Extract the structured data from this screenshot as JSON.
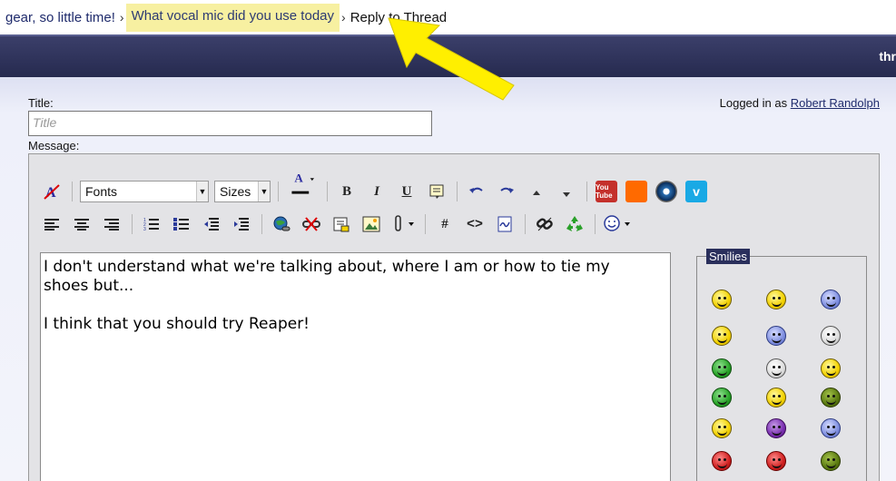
{
  "breadcrumb": {
    "item1": "gear, so little time!",
    "sep": "›",
    "item2": "What vocal mic did you use today",
    "current": "Reply to Thread"
  },
  "navbar": {
    "right_text": "thr"
  },
  "form": {
    "title_label": "Title:",
    "title_placeholder": "Title",
    "message_label": "Message:",
    "logged_in_prefix": "Logged in as",
    "logged_in_user": "Robert Randolph"
  },
  "toolbar": {
    "fonts": "Fonts",
    "sizes": "Sizes",
    "bold": "B",
    "italic": "I",
    "underline": "U",
    "hash": "#",
    "code": "<>",
    "youtube": "You Tube",
    "vimeo": "v"
  },
  "message": {
    "text": "I don't understand what we're talking about, where I am or how to tie my\nshoes but...\n\nI think that you should try Reaper!"
  },
  "smilies": {
    "legend": "Smilies"
  },
  "colors": {
    "highlight": "#f7f0a1",
    "arrow": "#ffef00",
    "navbar": "#2a2f5c"
  }
}
